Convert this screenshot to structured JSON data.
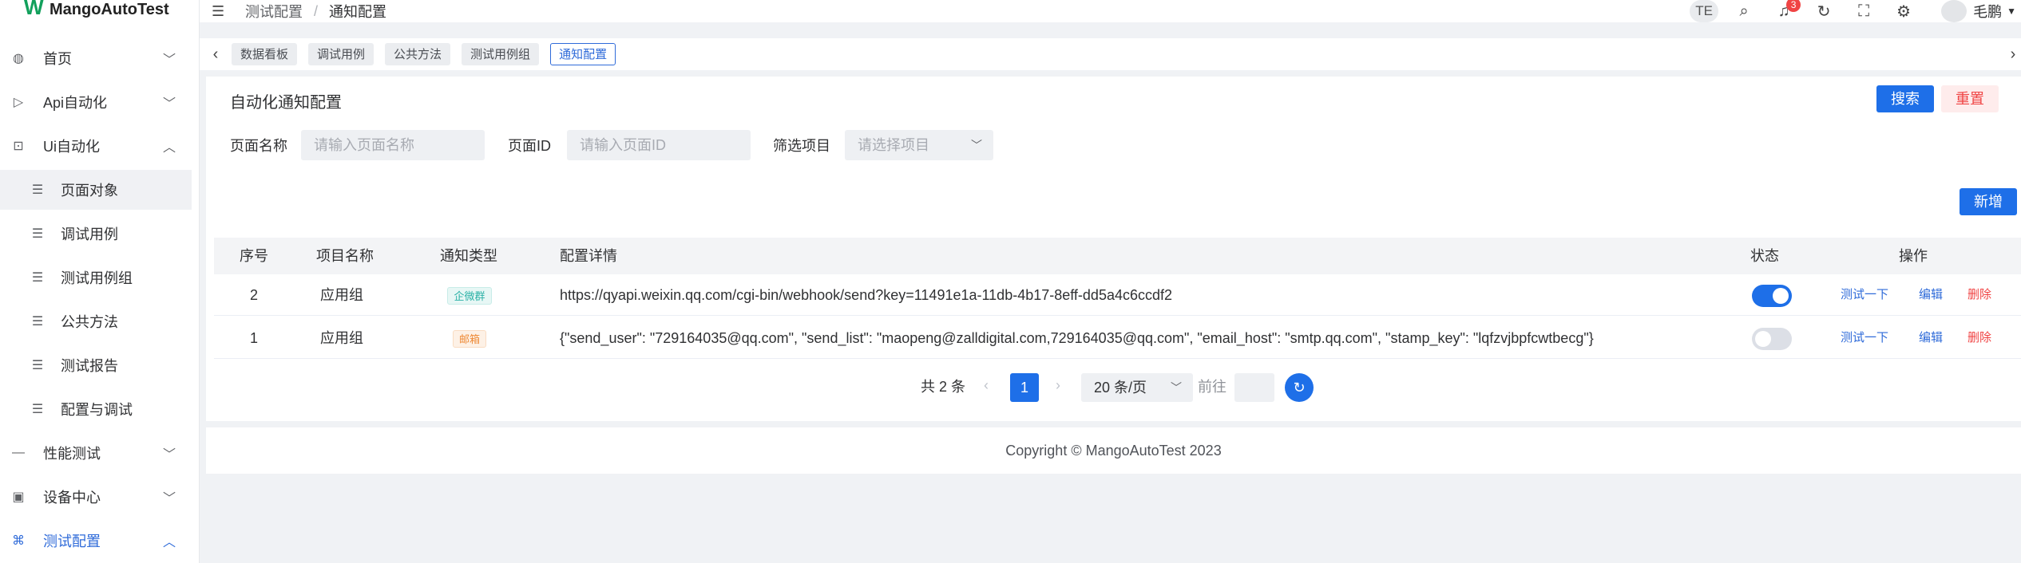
{
  "app": {
    "logo_text": "MangoAutoTest"
  },
  "sidebar": {
    "items": [
      {
        "label": "首页",
        "icon": "palette-icon"
      },
      {
        "label": "Api自动化",
        "icon": "send-icon"
      },
      {
        "label": "Ui自动化",
        "icon": "inspect-icon"
      },
      {
        "label": "页面对象",
        "icon": "list-icon"
      },
      {
        "label": "调试用例",
        "icon": "list-icon"
      },
      {
        "label": "测试用例组",
        "icon": "list-icon"
      },
      {
        "label": "公共方法",
        "icon": "list-icon"
      },
      {
        "label": "测试报告",
        "icon": "list-icon"
      },
      {
        "label": "配置与调试",
        "icon": "list-icon"
      },
      {
        "label": "性能测试",
        "icon": "minus-icon"
      },
      {
        "label": "设备中心",
        "icon": "device-icon"
      },
      {
        "label": "测试配置",
        "icon": "command-icon"
      }
    ]
  },
  "header": {
    "breadcrumb": [
      "测试配置",
      "通知配置"
    ],
    "breadcrumb_sep": "/",
    "user_initials": "TE",
    "notification_count": "3",
    "user_name": "毛鹏"
  },
  "tabs": [
    "数据看板",
    "调试用例",
    "公共方法",
    "测试用例组",
    "通知配置"
  ],
  "card": {
    "title": "自动化通知配置",
    "search_label": "搜索",
    "reset_label": "重置",
    "add_label": "新增"
  },
  "filters": {
    "page_name_label": "页面名称",
    "page_name_placeholder": "请输入页面名称",
    "page_id_label": "页面ID",
    "page_id_placeholder": "请输入页面ID",
    "project_label": "筛选项目",
    "project_placeholder": "请选择项目"
  },
  "table": {
    "columns": [
      "序号",
      "项目名称",
      "通知类型",
      "配置详情",
      "状态",
      "操作"
    ],
    "rows": [
      {
        "index": "2",
        "project": "应用组",
        "type": "企微群",
        "type_color": "cyan",
        "config": "https://qyapi.weixin.qq.com/cgi-bin/webhook/send?key=11491e1a-11db-4b17-8eff-dd5a4c6ccdf2",
        "status_on": true,
        "actions": [
          "测试一下",
          "编辑",
          "删除"
        ]
      },
      {
        "index": "1",
        "project": "应用组",
        "type": "邮箱",
        "type_color": "orange",
        "config": "{\"send_user\": \"729164035@qq.com\", \"send_list\": \"maopeng@zalldigital.com,729164035@qq.com\", \"email_host\": \"smtp.qq.com\", \"stamp_key\": \"lqfzvjbpfcwtbecg\"}",
        "status_on": false,
        "actions": [
          "测试一下",
          "编辑",
          "删除"
        ]
      }
    ]
  },
  "pagination": {
    "total_text": "共 2 条",
    "current_page": "1",
    "page_size": "20 条/页",
    "goto_label": "前往"
  },
  "footer": {
    "copyright": "Copyright © MangoAutoTest 2023"
  },
  "colors": {
    "primary": "#1e6fe8",
    "danger": "#f04444",
    "cyan_tag": "#2ab1a6",
    "orange_tag": "#ee8a37"
  }
}
